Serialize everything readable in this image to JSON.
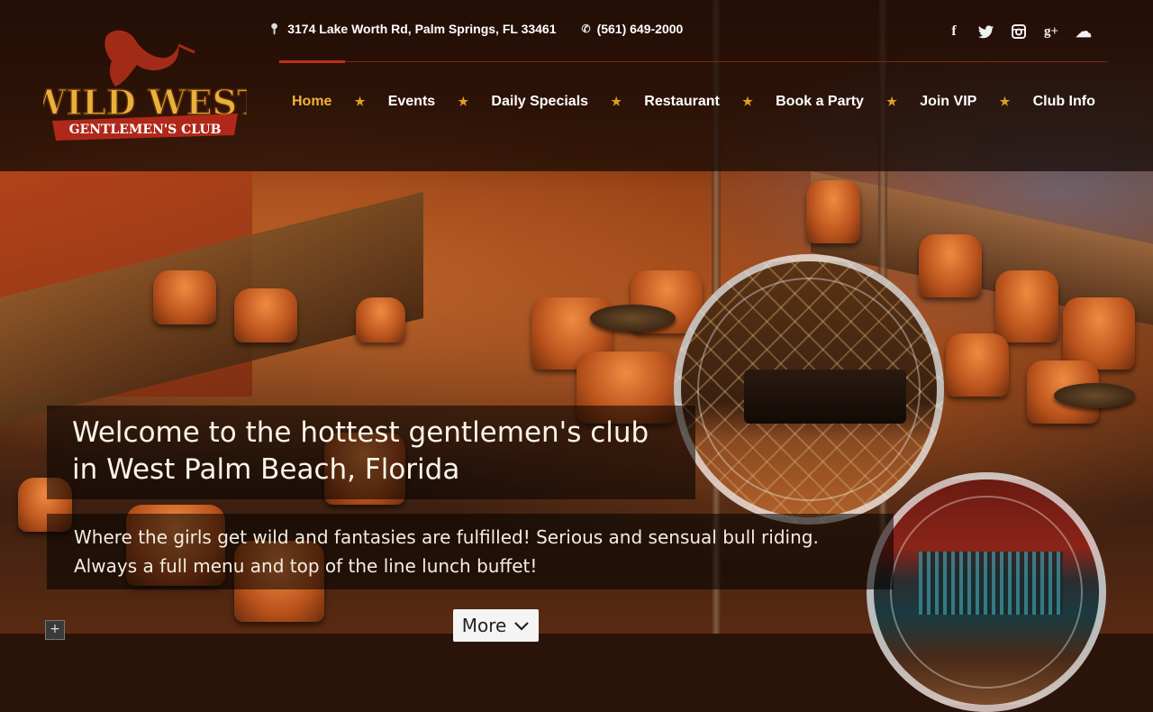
{
  "brand": {
    "logo_line1": "WILD WEST",
    "logo_line2": "GENTLEMEN'S CLUB",
    "accent_gold": "#f0b23a",
    "accent_red": "#c0301a"
  },
  "contact": {
    "address_icon": "map-pin-icon",
    "address": "3174 Lake Worth Rd, Palm Springs, FL 33461",
    "phone_icon": "phone-icon",
    "phone": "(561) 649-2000"
  },
  "social": [
    {
      "name": "facebook-icon",
      "glyph": "f"
    },
    {
      "name": "twitter-icon",
      "glyph": "🐦"
    },
    {
      "name": "instagram-icon",
      "glyph": "◙"
    },
    {
      "name": "google-plus-icon",
      "glyph": "g+"
    },
    {
      "name": "soundcloud-icon",
      "glyph": "☁"
    }
  ],
  "nav": {
    "items": [
      {
        "label": "Home",
        "active": true
      },
      {
        "label": "Events",
        "active": false
      },
      {
        "label": "Daily Specials",
        "active": false
      },
      {
        "label": "Restaurant",
        "active": false
      },
      {
        "label": "Book a Party",
        "active": false
      },
      {
        "label": "Join VIP",
        "active": false
      },
      {
        "label": "Club Info",
        "active": false
      }
    ],
    "separator": "★"
  },
  "hero": {
    "headline_line1": "Welcome to the hottest gentlemen's club",
    "headline_line2": "in West Palm Beach, Florida",
    "tagline_line1": "Where the girls get wild and fantasies are fulfilled! Serious and sensual bull riding.",
    "tagline_line2": "Always a full menu and top of the line lunch buffet!",
    "more_label": "More",
    "more_icon": "chevron-down-icon",
    "plus_label": "+"
  }
}
